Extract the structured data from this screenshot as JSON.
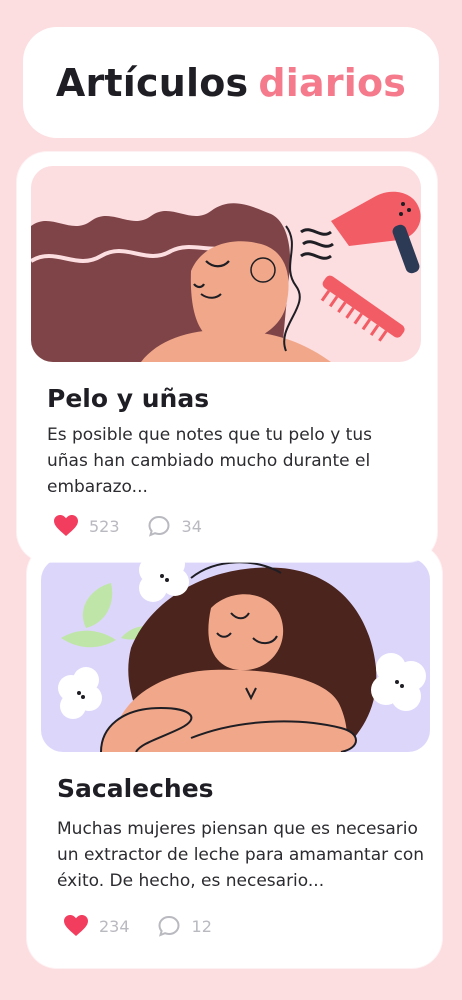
{
  "header": {
    "title_main": "Artículos",
    "title_accent": "diarios"
  },
  "colors": {
    "background": "#fcdde0",
    "accent": "#f47a8c",
    "heart": "#f23d5f",
    "muted": "#b9b9c0",
    "text": "#1e1e24"
  },
  "articles": [
    {
      "title": "Pelo y uñas",
      "description": "Es posible que notes que tu pelo y tus uñas han cambiado mucho durante el embarazo...",
      "likes": "523",
      "comments": "34",
      "illustration": "woman-hair-dryer-comb"
    },
    {
      "title": "Sacaleches",
      "description": "Muchas mujeres piensan que es necesario un extractor de leche para amamantar con éxito. De hecho, es necesario...",
      "likes": "234",
      "comments": "12",
      "illustration": "woman-embracing-flowers"
    }
  ]
}
